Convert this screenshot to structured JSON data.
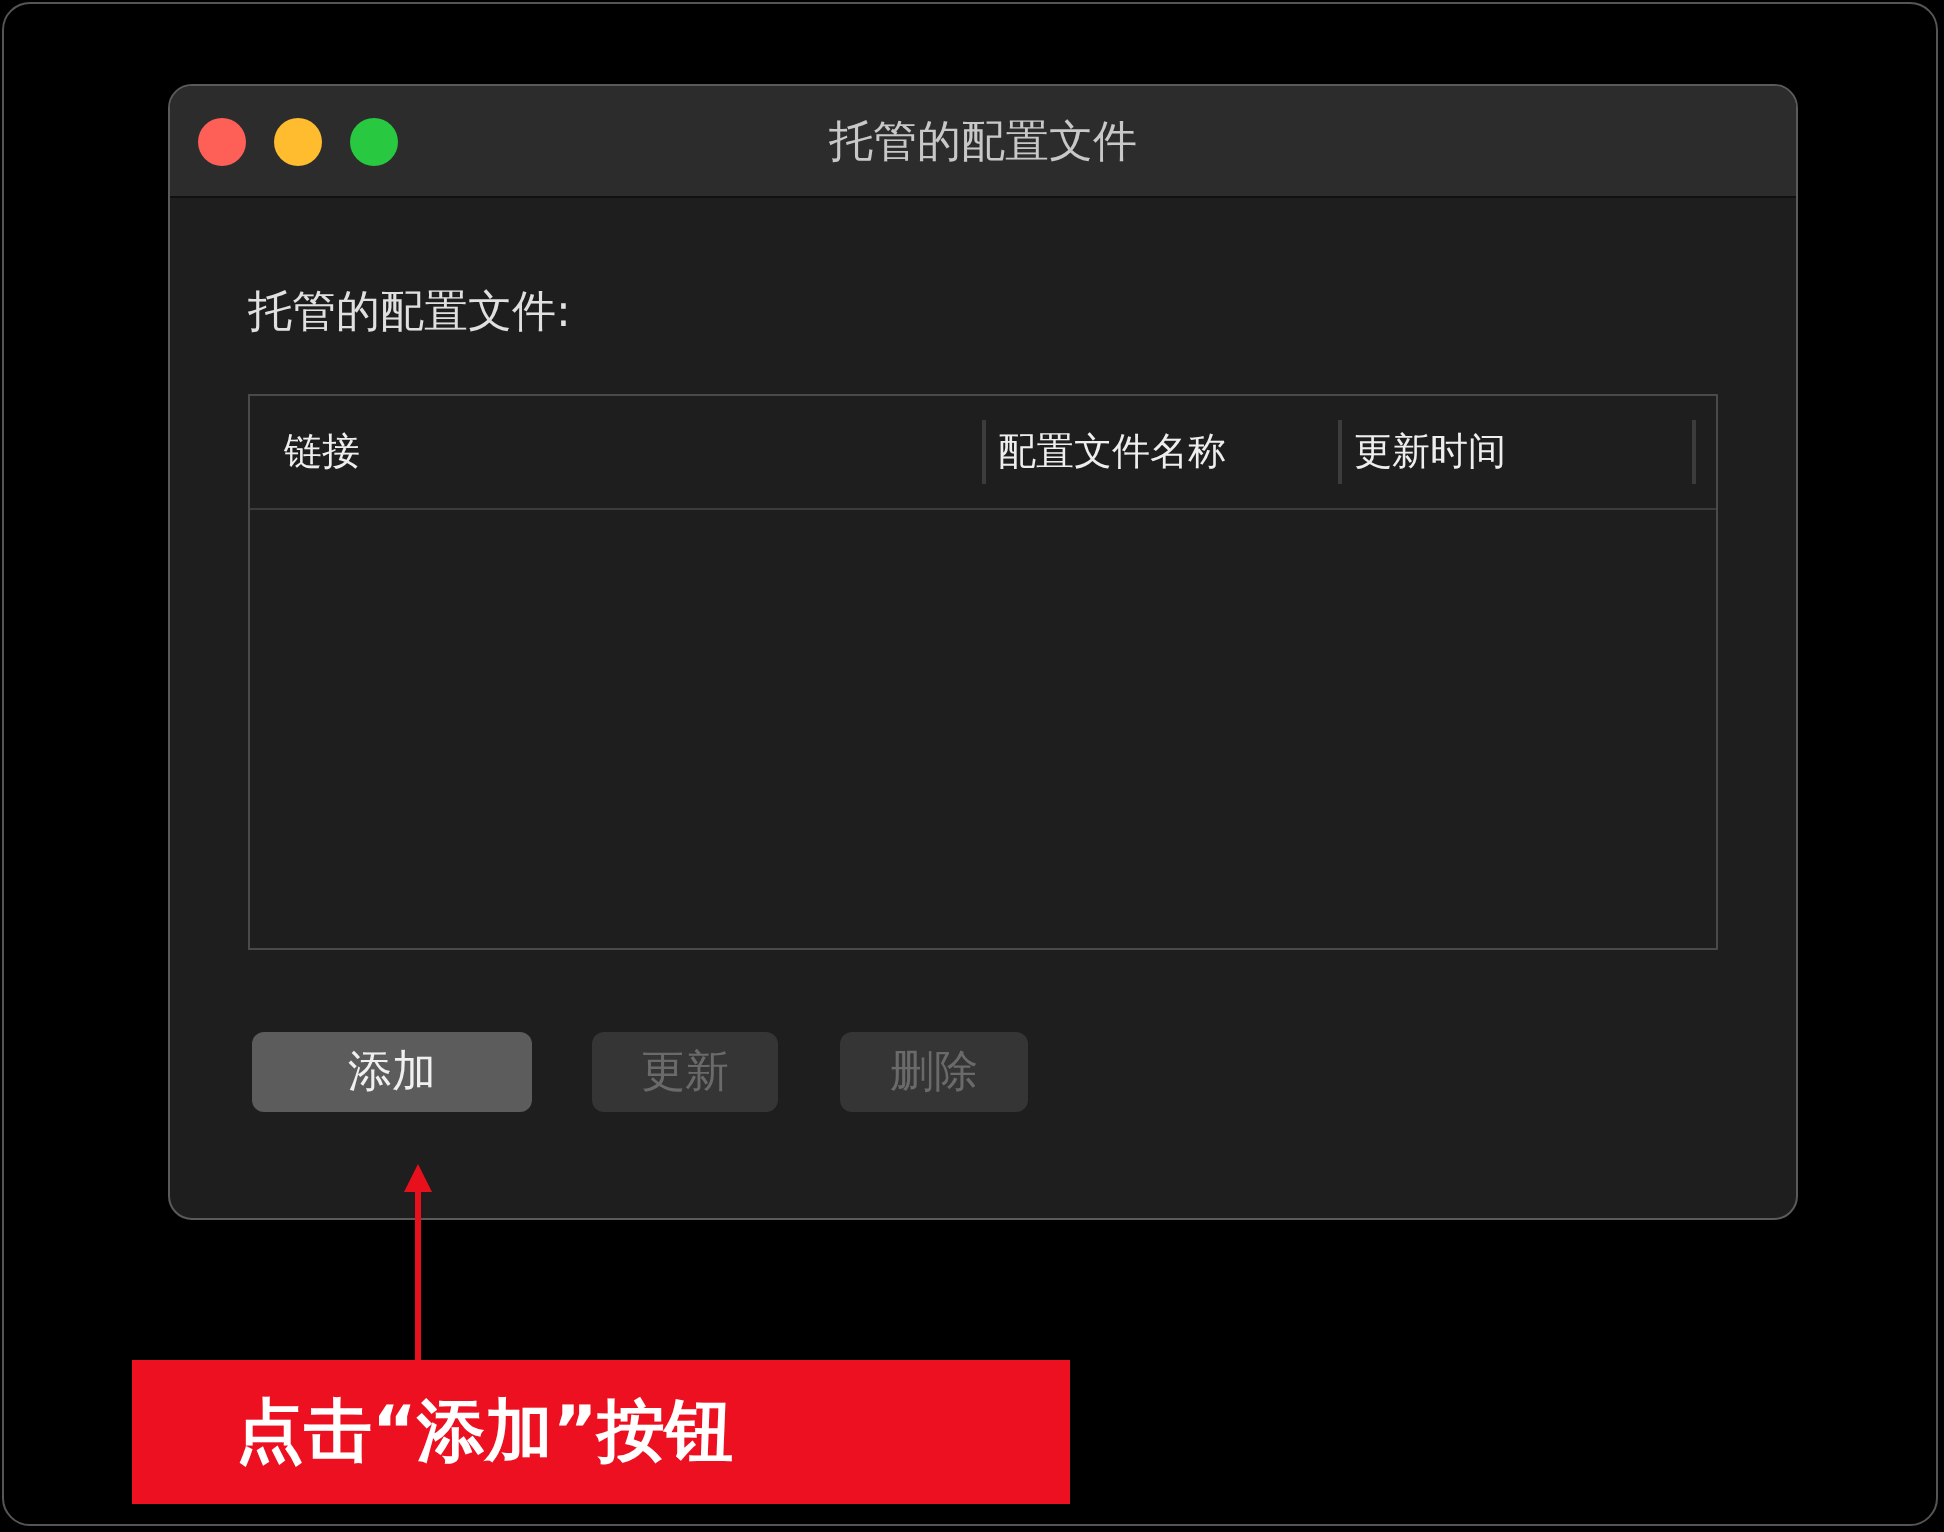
{
  "window": {
    "title": "托管的配置文件"
  },
  "section_label": "托管的配置文件:",
  "table": {
    "columns": [
      "链接",
      "配置文件名称",
      "更新时间"
    ]
  },
  "buttons": [
    {
      "label": "添加",
      "disabled": false
    },
    {
      "label": "更新",
      "disabled": true
    },
    {
      "label": "删除",
      "disabled": true
    }
  ],
  "annotation": {
    "text": "点击“添加”按钮"
  }
}
